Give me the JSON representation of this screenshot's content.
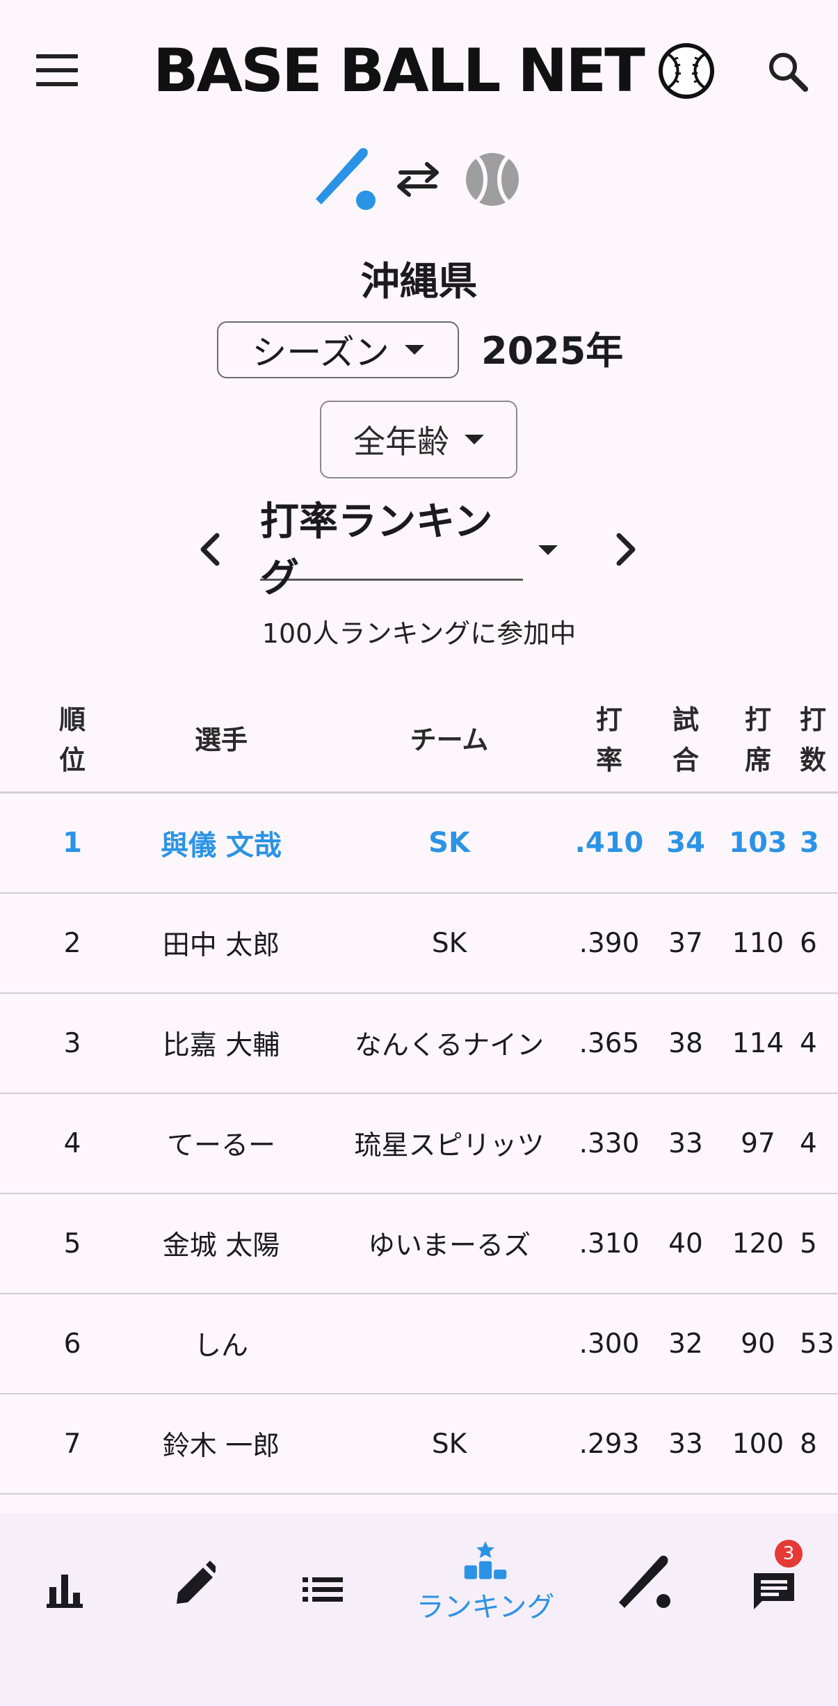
{
  "header": {
    "logo_text": "BASE BALL NET",
    "menu_icon": "hamburger-menu-icon",
    "search_icon": "search-icon"
  },
  "mode_toggle": {
    "left_icon": "bat-icon",
    "middle_icon": "swap-arrows-icon",
    "right_icon": "baseball-icon",
    "active_color": "#2b93e6",
    "inactive_color": "#9e9e9e"
  },
  "prefecture": "沖縄県",
  "season_select": {
    "value": "シーズン"
  },
  "year": "2025年",
  "age_select": {
    "value": "全年齢"
  },
  "ranking_select": {
    "value": "打率ランキング"
  },
  "participants_text": "100人ランキングに参加中",
  "table": {
    "headers": {
      "rank": "順\n位",
      "player": "選手",
      "team": "チーム",
      "avg": "打\n率",
      "games": "試\n合",
      "pa": "打\n席",
      "ab": "打\n数"
    },
    "rows": [
      {
        "rank": "1",
        "player": "與儀 文哉",
        "team": "SK",
        "avg": ".410",
        "games": "34",
        "pa": "103",
        "ab": "3"
      },
      {
        "rank": "2",
        "player": "田中 太郎",
        "team": "SK",
        "avg": ".390",
        "games": "37",
        "pa": "110",
        "ab": "6"
      },
      {
        "rank": "3",
        "player": "比嘉 大輔",
        "team": "なんくるナイン",
        "avg": ".365",
        "games": "38",
        "pa": "114",
        "ab": "4"
      },
      {
        "rank": "4",
        "player": "てーるー",
        "team": "琉星スピリッツ",
        "avg": ".330",
        "games": "33",
        "pa": "97",
        "ab": "4"
      },
      {
        "rank": "5",
        "player": "金城 太陽",
        "team": "ゆいまーるズ",
        "avg": ".310",
        "games": "40",
        "pa": "120",
        "ab": "5"
      },
      {
        "rank": "6",
        "player": "しん",
        "team": "",
        "avg": ".300",
        "games": "32",
        "pa": "90",
        "ab": "53"
      },
      {
        "rank": "7",
        "player": "鈴木 一郎",
        "team": "SK",
        "avg": ".293",
        "games": "33",
        "pa": "100",
        "ab": "8"
      }
    ],
    "highlight_color": "#2b93e6"
  },
  "bottom_nav": {
    "items": [
      {
        "icon": "bar-chart-icon"
      },
      {
        "icon": "pencil-icon"
      },
      {
        "icon": "list-icon"
      },
      {
        "icon": "ranking-podium-icon",
        "label": "ランキング"
      },
      {
        "icon": "bat-icon"
      },
      {
        "icon": "chat-icon",
        "badge": "3"
      }
    ]
  }
}
